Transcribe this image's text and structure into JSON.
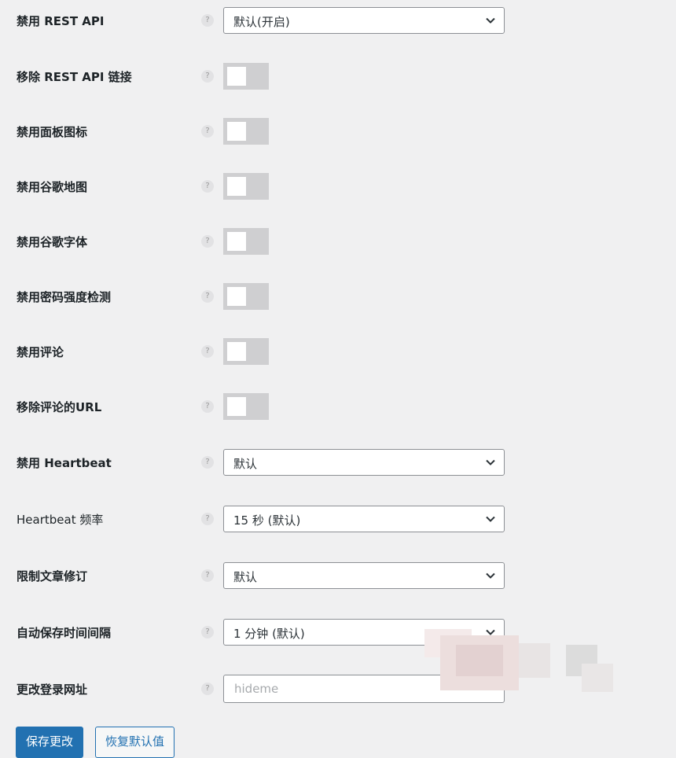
{
  "settings": [
    {
      "label": "禁用 REST API",
      "type": "select",
      "value": "默认(开启)"
    },
    {
      "label": "移除 REST API 链接",
      "type": "toggle",
      "value": "off"
    },
    {
      "label": "禁用面板图标",
      "type": "toggle",
      "value": "off"
    },
    {
      "label": "禁用谷歌地图",
      "type": "toggle",
      "value": "off"
    },
    {
      "label": "禁用谷歌字体",
      "type": "toggle",
      "value": "off"
    },
    {
      "label": "禁用密码强度检测",
      "type": "toggle",
      "value": "off"
    },
    {
      "label": "禁用评论",
      "type": "toggle",
      "value": "off"
    },
    {
      "label": "移除评论的URL",
      "type": "toggle",
      "value": "off"
    },
    {
      "label": "禁用 Heartbeat",
      "type": "select",
      "value": "默认"
    },
    {
      "label": "Heartbeat 频率",
      "type": "select",
      "value": "15 秒 (默认)"
    },
    {
      "label": "限制文章修订",
      "type": "select",
      "value": "默认"
    },
    {
      "label": "自动保存时间间隔",
      "type": "select",
      "value": "1 分钟 (默认)"
    },
    {
      "label": "更改登录网址",
      "type": "text",
      "value": "",
      "placeholder": "hideme"
    }
  ],
  "help_glyph": "?",
  "buttons": {
    "save_label": "保存更改",
    "reset_label": "恢复默认值"
  },
  "colors": {
    "background": "#f0f0f1",
    "primary": "#2271b1",
    "toggle_off": "#cfcfd1"
  }
}
